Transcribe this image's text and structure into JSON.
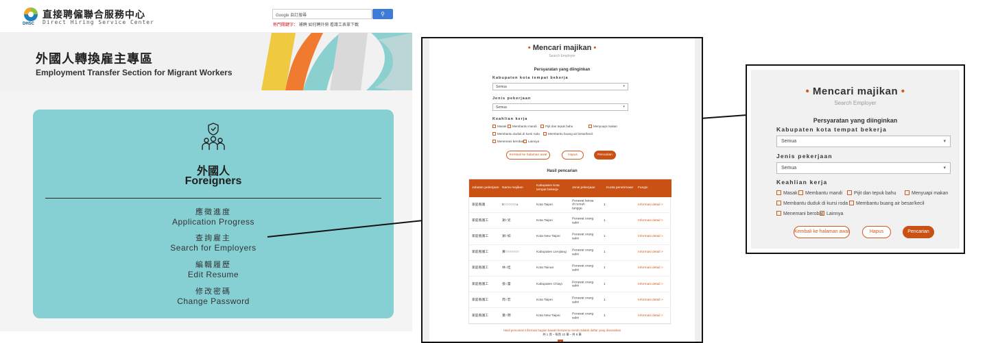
{
  "colors": {
    "accent": "#c95114",
    "teal": "#86cfd3",
    "search_blue": "#3d7bd7",
    "hot_red": "#d0202a"
  },
  "site": {
    "title_zh": "直接聘僱聯合服務中心",
    "title_en": "Direct Hiring Service Center",
    "logo_abbr": "DHSC",
    "search_text": "Google 自訂搜尋",
    "hot_label": "熱門關鍵字：",
    "hot_keywords": "補聘  如何聘外勞  看護工表單下載"
  },
  "banner": {
    "title_zh": "外國人轉換雇主專區",
    "title_en": "Employment Transfer Section for Migrant Workers"
  },
  "card": {
    "heading_zh": "外國人",
    "heading_en": "Foreigners",
    "icon": "people-group-icon",
    "menu": [
      {
        "zh": "應徵進度",
        "en": "Application Progress"
      },
      {
        "zh": "查詢雇主",
        "en": "Search for Employers"
      },
      {
        "zh": "編輯履歷",
        "en": "Edit Resume"
      },
      {
        "zh": "修改密碼",
        "en": "Change Password"
      }
    ]
  },
  "search_form": {
    "title": "Mencari majikan",
    "subtitle": "Search Employer",
    "criteria_heading": "Persyaratan yang diinginkan",
    "region_label": "Kabupaten kota tempat bekerja",
    "region_value": "Semua",
    "job_label": "Jenis pekerjaan",
    "job_value": "Semua",
    "skills_label": "Keahlian kerja",
    "skills": [
      "Masak",
      "Membantu mandi",
      "Pijit dan tepuk bahu",
      "Menyuapi makan",
      "Membantu duduk di kursi roda",
      "Membantu buang air besar/kecil",
      "Menemani berobat",
      "Lainnya"
    ],
    "buttons": {
      "back": "Kembali ke halaman awal",
      "clear": "Hapus",
      "search": "Pencarian"
    }
  },
  "results": {
    "heading": "Hasil pencarian",
    "columns": [
      "Jabatan pekerjaan",
      "Nama majikan",
      "Kabupaten kota tempat bekerja",
      "Jenis pekerjaan",
      "Kuota penerimaan",
      "Fungsi"
    ],
    "rows": [
      {
        "job": "家庭看護",
        "employer": "E○○○○○○u",
        "city": "Kota Taipei",
        "type": "Perawat lansia di rumah tangga",
        "quota": "1",
        "action": "Informasi detail >"
      },
      {
        "job": "家庭看護工",
        "employer": "謝○兒",
        "city": "Kota Taipei",
        "type": "Perawat orang sakit",
        "quota": "1",
        "action": "Informasi detail >"
      },
      {
        "job": "家庭看護工",
        "employer": "謝○如",
        "city": "Kota New Taipei",
        "type": "Perawat orang sakit",
        "quota": "1",
        "action": "Informasi detail >"
      },
      {
        "job": "家庭看護工",
        "employer": "黃○○○○○○○",
        "city": "Kabupaten Lienjiang",
        "type": "Perawat orang sakit",
        "quota": "1",
        "action": "Informasi detail >"
      },
      {
        "job": "家庭看護工",
        "employer": "林○桂",
        "city": "Kota Tainan",
        "type": "Perawat orang sakit",
        "quota": "1",
        "action": "Informasi detail >"
      },
      {
        "job": "家庭看護工",
        "employer": "張○蕾",
        "city": "Kabupaten Chiayi",
        "type": "Perawat orang sakit",
        "quota": "1",
        "action": "Informasi detail >"
      },
      {
        "job": "家庭看護工",
        "employer": "周○宏",
        "city": "Kota Taipei",
        "type": "Perawat orang sakit",
        "quota": "1",
        "action": "Informasi detail >"
      },
      {
        "job": "家庭看護工",
        "employer": "葉○明",
        "city": "Kota New Taipei",
        "type": "Perawat orang sakit",
        "quota": "1",
        "action": "Informasi detail >"
      }
    ],
    "note": "Hasil pencarian informasi bagian bawah berwarna merah adalah daftar yang disarankan",
    "pager": "共 1 頁・每頁 10 筆・共 8 筆",
    "current_page": "1"
  }
}
